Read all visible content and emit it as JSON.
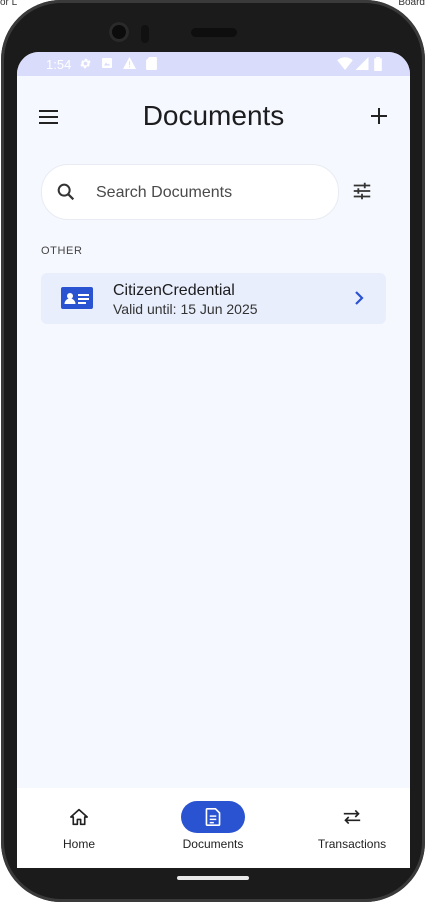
{
  "browser_fragments": {
    "left": "or  L",
    "right": "Board"
  },
  "status_bar": {
    "time": "1:54"
  },
  "app_bar": {
    "title": "Documents"
  },
  "search": {
    "placeholder": "Search Documents",
    "value": ""
  },
  "section": {
    "label": "OTHER"
  },
  "documents": [
    {
      "name": "CitizenCredential",
      "valid_until": "Valid until: 15 Jun 2025"
    }
  ],
  "bottom_nav": {
    "items": [
      {
        "label": "Home",
        "icon": "home-icon",
        "active": false
      },
      {
        "label": "Documents",
        "icon": "document-icon",
        "active": true
      },
      {
        "label": "Transactions",
        "icon": "swap-arrows-icon",
        "active": false
      }
    ]
  },
  "colors": {
    "accent": "#2a53d2",
    "screen_bg": "#f5f8fe",
    "status_bar_bg": "#dadcfb",
    "card_bg": "#e8eefc"
  }
}
